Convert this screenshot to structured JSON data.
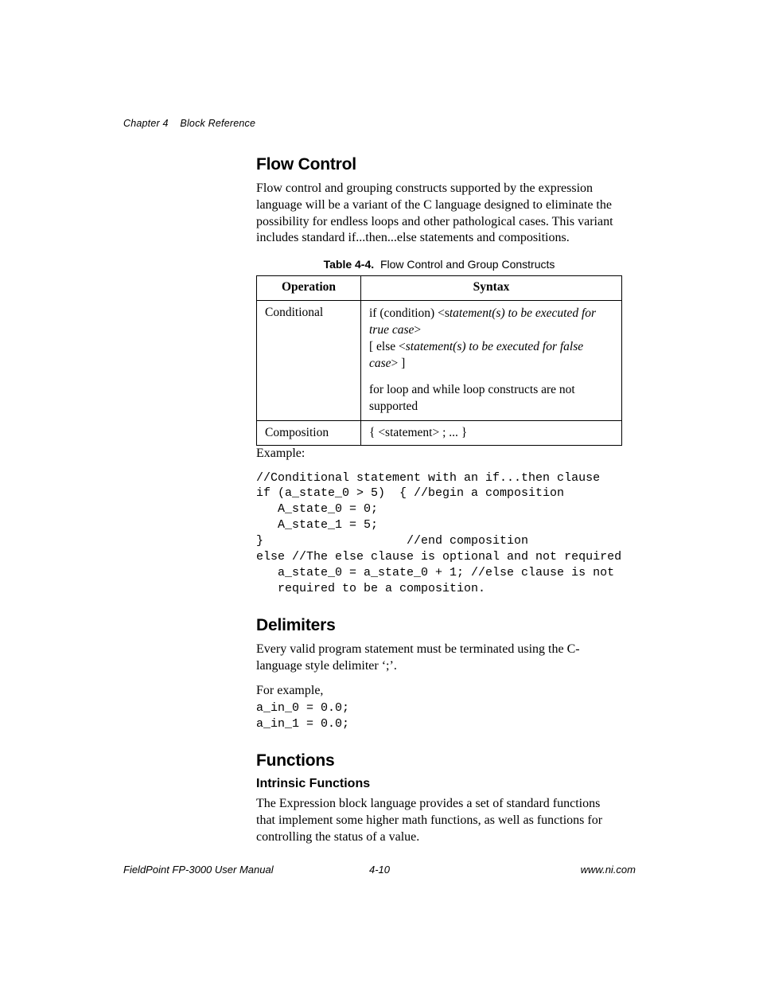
{
  "header": {
    "chapter_label": "Chapter 4",
    "chapter_title": "Block Reference"
  },
  "sections": {
    "flow_control": {
      "heading": "Flow Control",
      "para": "Flow control and grouping constructs supported by the expression language will be a variant of the C language designed to eliminate the possibility for endless loops and other pathological cases. This variant includes standard if...then...else statements and compositions.",
      "table_caption_label": "Table 4-4.",
      "table_caption_text": "Flow Control and Group Constructs",
      "table": {
        "col_operation": "Operation",
        "col_syntax": "Syntax",
        "row1_op": "Conditional",
        "row1_syntax_l1_pre": "if (condition) <s",
        "row1_syntax_l1_ital": "tatement(s) to be executed for true case",
        "row1_syntax_l1_post": ">",
        "row1_syntax_l2_pre": "[ else <",
        "row1_syntax_l2_ital": "statement(s) to be executed for false case",
        "row1_syntax_l2_post": "> ]",
        "row1_syntax_l3": "for loop and while loop constructs are not supported",
        "row2_op": "Composition",
        "row2_syntax": "{ <statement> ; ... }"
      },
      "example_label": "Example:",
      "example_code": "//Conditional statement with an if...then clause\nif (a_state_0 > 5)  { //begin a composition\n   A_state_0 = 0;\n   A_state_1 = 5;\n}                    //end composition\nelse //The else clause is optional and not required\n   a_state_0 = a_state_0 + 1; //else clause is not \n   required to be a composition."
    },
    "delimiters": {
      "heading": "Delimiters",
      "para": "Every valid program statement must be terminated using the C-language style delimiter ‘;’.",
      "for_example": "For example,",
      "code": "a_in_0 = 0.0;\na_in_1 = 0.0;"
    },
    "functions": {
      "heading": "Functions",
      "sub_heading": "Intrinsic Functions",
      "para": "The Expression block language provides a set of standard functions that implement some higher math functions, as well as functions for controlling the status of a value."
    }
  },
  "footer": {
    "left": "FieldPoint FP-3000 User Manual",
    "center": "4-10",
    "right": "www.ni.com"
  }
}
